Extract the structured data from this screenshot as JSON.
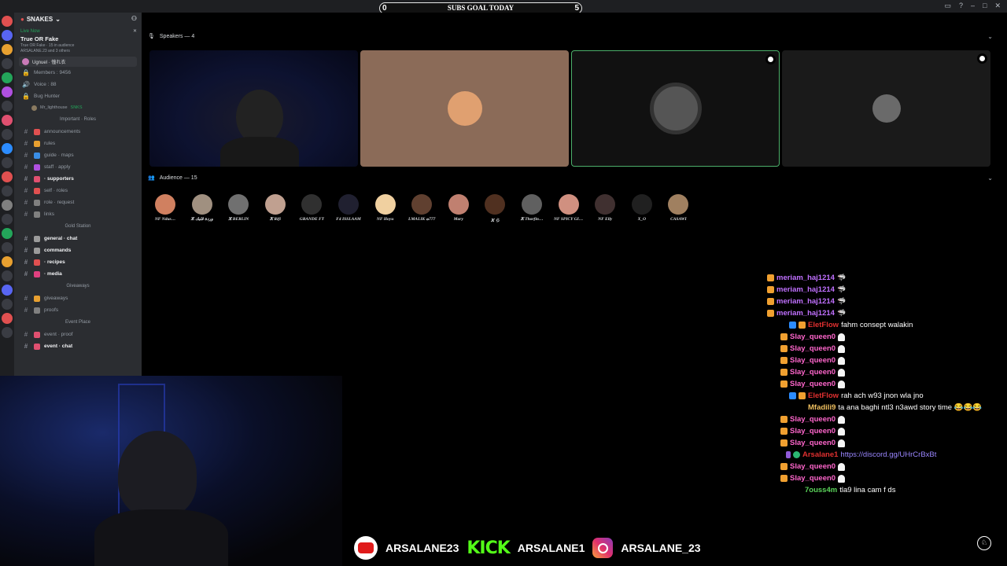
{
  "goal": {
    "title": "SUBS GOAL TODAY",
    "current": "0",
    "target": "5",
    "progress_fraction": 0.0
  },
  "window_controls": [
    "▭",
    "?",
    "–",
    "□",
    "✕"
  ],
  "server": {
    "name": "SNAKES"
  },
  "live": {
    "status": "Live Now",
    "stage_title": "True OR Fake",
    "stage_sub": "True OR Fake · 15 in audience",
    "speakers_line": "ARSALANE.23 and 3 others",
    "host_user": "Ugnuel · 憧れ衣"
  },
  "channels": [
    {
      "icon": "lock",
      "label": "Members : 9456"
    },
    {
      "icon": "voice",
      "label": "Voice : 88"
    },
    {
      "icon": "lock",
      "label": "Bug Hunter"
    }
  ],
  "voice_user": {
    "name": "Mr_lighthouse",
    "tag": "SNKS"
  },
  "category_important": "Important · Roles",
  "important_channels": [
    {
      "label": "announcements",
      "color": "#e05050",
      "bold": false
    },
    {
      "label": "rules",
      "color": "#e8a030",
      "bold": false
    },
    {
      "label": "guide · maps",
      "color": "#3a8ee6",
      "bold": false
    },
    {
      "label": "staff · apply",
      "color": "#b050e0",
      "bold": false
    },
    {
      "label": "· supporters",
      "color": "#e05070",
      "bold": true
    },
    {
      "label": "self · roles",
      "color": "#e05050",
      "bold": false
    },
    {
      "label": "role · request",
      "color": "#808080",
      "bold": false
    },
    {
      "label": "links",
      "color": "#808080",
      "bold": false
    }
  ],
  "category_gold": "Gold Station",
  "gold_channels": [
    {
      "label": "general · chat",
      "color": "#9b9b9b",
      "bold": true
    },
    {
      "label": "commands",
      "color": "#9b9b9b",
      "bold": true
    },
    {
      "label": "· recipes",
      "color": "#e05050",
      "bold": true
    },
    {
      "label": "· media",
      "color": "#e04080",
      "bold": true
    }
  ],
  "category_giveaways": "Giveaways",
  "giveaway_channels": [
    {
      "label": "giveaways",
      "color": "#e8a030",
      "bold": false
    },
    {
      "label": "proofs",
      "color": "#808080",
      "bold": false
    }
  ],
  "category_event": "Event Place",
  "event_channels": [
    {
      "label": "event · proof",
      "color": "#e05070",
      "bold": false
    },
    {
      "label": "event · chat",
      "color": "#e05070",
      "bold": true
    }
  ],
  "speakers_header": "Speakers — 4",
  "audience_header": "Audience — 15",
  "speakers": [
    {
      "bg": "#0d1230",
      "avatar": "#1d2a80"
    },
    {
      "bg": "#8b6b58",
      "avatar": "#e0a070"
    },
    {
      "bg": "#111111",
      "avatar": "#555555"
    },
    {
      "bg": "#1a1a1a",
      "avatar": "#6a6a6a"
    }
  ],
  "audience": [
    {
      "name": "NF Ndus…",
      "color": "#d08060"
    },
    {
      "name": "ⵣ وردة قلبك",
      "color": "#a09080"
    },
    {
      "name": "ⵣ BERLIN",
      "color": "#707070"
    },
    {
      "name": "ⵣ Rifi",
      "color": "#c0a090"
    },
    {
      "name": "GRANDE FT",
      "color": "#303030"
    },
    {
      "name": "F4 ISSLAAM",
      "color": "#202030"
    },
    {
      "name": "NF Hoyu",
      "color": "#f0d0a0"
    },
    {
      "name": "LMALIK ⴰ777",
      "color": "#604030"
    },
    {
      "name": "Mary",
      "color": "#c08070"
    },
    {
      "name": "ⵣ ら",
      "color": "#503020"
    },
    {
      "name": "ⵣ Thorfin…",
      "color": "#606060"
    },
    {
      "name": "NF SPICY GI…",
      "color": "#d09080"
    },
    {
      "name": "NF Elly",
      "color": "#403030"
    },
    {
      "name": "X_O",
      "color": "#202020"
    },
    {
      "name": "CASAWI",
      "color": "#a08060"
    }
  ],
  "chat": [
    {
      "user": "meriam_haj1214",
      "color": "#c070ff",
      "text": "",
      "badges": [
        "crown"
      ],
      "emote": "fish",
      "indent": 0
    },
    {
      "user": "meriam_haj1214",
      "color": "#c070ff",
      "text": "",
      "badges": [
        "crown"
      ],
      "emote": "fish",
      "indent": 0
    },
    {
      "user": "meriam_haj1214",
      "color": "#c070ff",
      "text": "",
      "badges": [
        "crown"
      ],
      "emote": "fish",
      "indent": 0
    },
    {
      "user": "meriam_haj1214",
      "color": "#c070ff",
      "text": "",
      "badges": [
        "crown"
      ],
      "emote": "fish",
      "indent": 0
    },
    {
      "user": "EletFlow",
      "color": "#e03030",
      "text": "fahm consept walakin",
      "badges": [
        "blue",
        "crown"
      ],
      "emote": "",
      "indent": 28
    },
    {
      "user": "Slay_queen0",
      "color": "#ff66cc",
      "text": "",
      "badges": [
        "crown"
      ],
      "emote": "ghost",
      "indent": 17
    },
    {
      "user": "Slay_queen0",
      "color": "#ff66cc",
      "text": "",
      "badges": [
        "crown"
      ],
      "emote": "ghost",
      "indent": 17
    },
    {
      "user": "Slay_queen0",
      "color": "#ff66cc",
      "text": "",
      "badges": [
        "crown"
      ],
      "emote": "ghost",
      "indent": 17
    },
    {
      "user": "Slay_queen0",
      "color": "#ff66cc",
      "text": "",
      "badges": [
        "crown"
      ],
      "emote": "ghost",
      "indent": 17
    },
    {
      "user": "Slay_queen0",
      "color": "#ff66cc",
      "text": "",
      "badges": [
        "crown"
      ],
      "emote": "ghost",
      "indent": 17
    },
    {
      "user": "EletFlow",
      "color": "#e03030",
      "text": "rah ach w93 jnon wla jno",
      "badges": [
        "blue",
        "crown"
      ],
      "emote": "",
      "indent": 28
    },
    {
      "user": "Mfadili9",
      "color": "#f0c060",
      "text": "ta ana baghi ntl3 n3awd story time 😂😂😂",
      "badges": [],
      "emote": "",
      "indent": 52
    },
    {
      "user": "Slay_queen0",
      "color": "#ff66cc",
      "text": "",
      "badges": [
        "crown"
      ],
      "emote": "ghost",
      "indent": 17
    },
    {
      "user": "Slay_queen0",
      "color": "#ff66cc",
      "text": "",
      "badges": [
        "crown"
      ],
      "emote": "ghost",
      "indent": 17
    },
    {
      "user": "Slay_queen0",
      "color": "#ff66cc",
      "text": "",
      "badges": [
        "crown"
      ],
      "emote": "ghost",
      "indent": 17
    },
    {
      "user": "Arsalane1",
      "color": "#e03030",
      "text": "https://discord.gg/UHrCrBxBt",
      "badges": [
        "mic",
        "green"
      ],
      "emote": "",
      "indent": 24,
      "link": true
    },
    {
      "user": "Slay_queen0",
      "color": "#ff66cc",
      "text": "",
      "badges": [
        "crown"
      ],
      "emote": "ghost",
      "indent": 17
    },
    {
      "user": "Slay_queen0",
      "color": "#ff66cc",
      "text": "",
      "badges": [
        "crown"
      ],
      "emote": "ghost",
      "indent": 17
    },
    {
      "user": "7ouss4m",
      "color": "#5ad35a",
      "text": "tla9 lina cam f ds",
      "badges": [],
      "emote": "",
      "indent": 48
    }
  ],
  "socials": {
    "youtube": "ARSALANE23",
    "kick_logo": "KICK",
    "kick": "ARSALANE1",
    "instagram": "ARSALANE_23"
  }
}
